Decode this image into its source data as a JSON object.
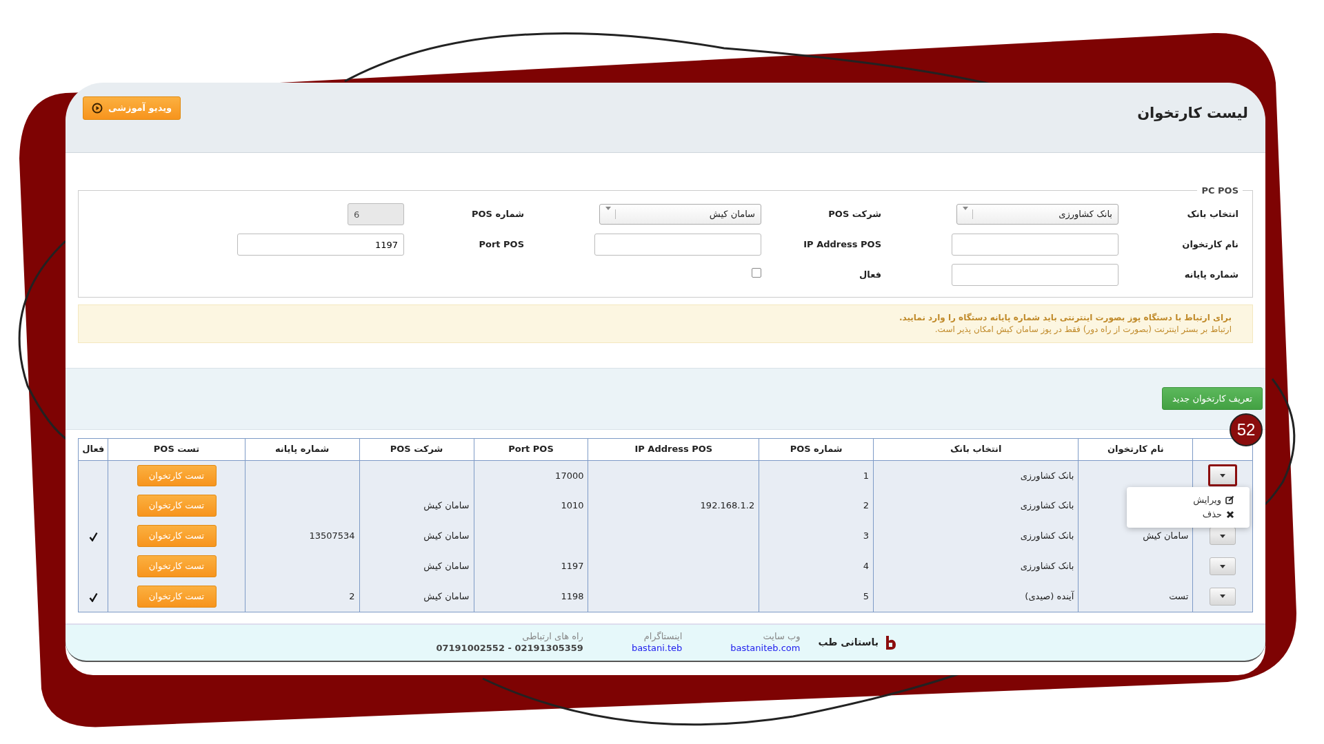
{
  "header": {
    "title": "لیست کارتخوان",
    "video_button": "ویدیو آموزشی"
  },
  "form": {
    "legend": "PC POS",
    "fields": [
      {
        "label": "انتخاب بانک",
        "kind": "select",
        "value": "بانک کشاورزی"
      },
      {
        "label": "شرکت POS",
        "kind": "select",
        "value": "سامان کیش"
      },
      {
        "label": "شماره POS",
        "kind": "text",
        "value": "6",
        "disabled": true
      },
      {
        "label": "نام کارتخوان",
        "kind": "text",
        "disabled": false
      },
      {
        "label": "IP Address POS",
        "kind": "text",
        "disabled": false
      },
      {
        "label": "Port POS",
        "kind": "text",
        "value": "1197",
        "disabled": false
      },
      {
        "label": "شماره پایانه",
        "kind": "text",
        "disabled": false
      },
      {
        "label": "فعال",
        "kind": "checkbox",
        "checked": false
      }
    ]
  },
  "notice": {
    "title": "برای ارتباط با دستگاه پوز بصورت اینترنتی باید شماره پایانه دستگاه را وارد نمایید.",
    "text": "ارتباط بر بستر اینترنت (بصورت از راه دور) فقط در پوز سامان کیش امکان پذیر است."
  },
  "new_button": "تعریف کارتخوان جدید",
  "step_badge": "52",
  "table": {
    "columns": [
      "نام کارتخوان",
      "انتخاب بانک",
      "شماره POS",
      "IP Address POS",
      "Port POS",
      "شرکت POS",
      "شماره پایانه",
      "تست POS",
      "فعال"
    ],
    "rows": [
      {
        "name": "",
        "bank": "بانک کشاورزی",
        "pos_number": "1",
        "ip": "",
        "port": "17000",
        "company": "",
        "terminal": "",
        "test_button": "تست کارتخوان",
        "active": false,
        "highlighted": true,
        "menu_open": true
      },
      {
        "name": "",
        "bank": "بانک کشاورزی",
        "pos_number": "2",
        "ip": "192.168.1.2",
        "port": "1010",
        "company": "سامان کیش",
        "terminal": "",
        "test_button": "تست کارتخوان",
        "active": false,
        "highlighted": false,
        "menu_open": false
      },
      {
        "name": "سامان کیش",
        "bank": "بانک کشاورزی",
        "pos_number": "3",
        "ip": "",
        "port": "",
        "company": "سامان کیش",
        "terminal": "13507534",
        "test_button": "تست کارتخوان",
        "active": true,
        "highlighted": false,
        "menu_open": false
      },
      {
        "name": "",
        "bank": "بانک کشاورزی",
        "pos_number": "4",
        "ip": "",
        "port": "1197",
        "company": "سامان کیش",
        "terminal": "",
        "test_button": "تست کارتخوان",
        "active": false,
        "highlighted": false,
        "menu_open": false
      },
      {
        "name": "تست",
        "bank": "آینده (صیدی)",
        "pos_number": "5",
        "ip": "",
        "port": "1198",
        "company": "سامان کیش",
        "terminal": "2",
        "test_button": "تست کارتخوان",
        "active": true,
        "highlighted": false,
        "menu_open": false
      }
    ]
  },
  "row_menu": {
    "items": [
      {
        "kind": "edit",
        "label": "ویرایش"
      },
      {
        "kind": "delete",
        "label": "حذف"
      }
    ]
  },
  "footer": {
    "brand": "باستانی طب",
    "contacts": [
      {
        "label": "وب سایت",
        "value": "bastaniteb.com",
        "kind": "link"
      },
      {
        "label": "اینستاگرام",
        "value": "bastani.teb",
        "kind": "link"
      },
      {
        "label": "راه های ارتباطی",
        "value": "07191002552 - 02191305359",
        "kind": "text"
      }
    ]
  }
}
